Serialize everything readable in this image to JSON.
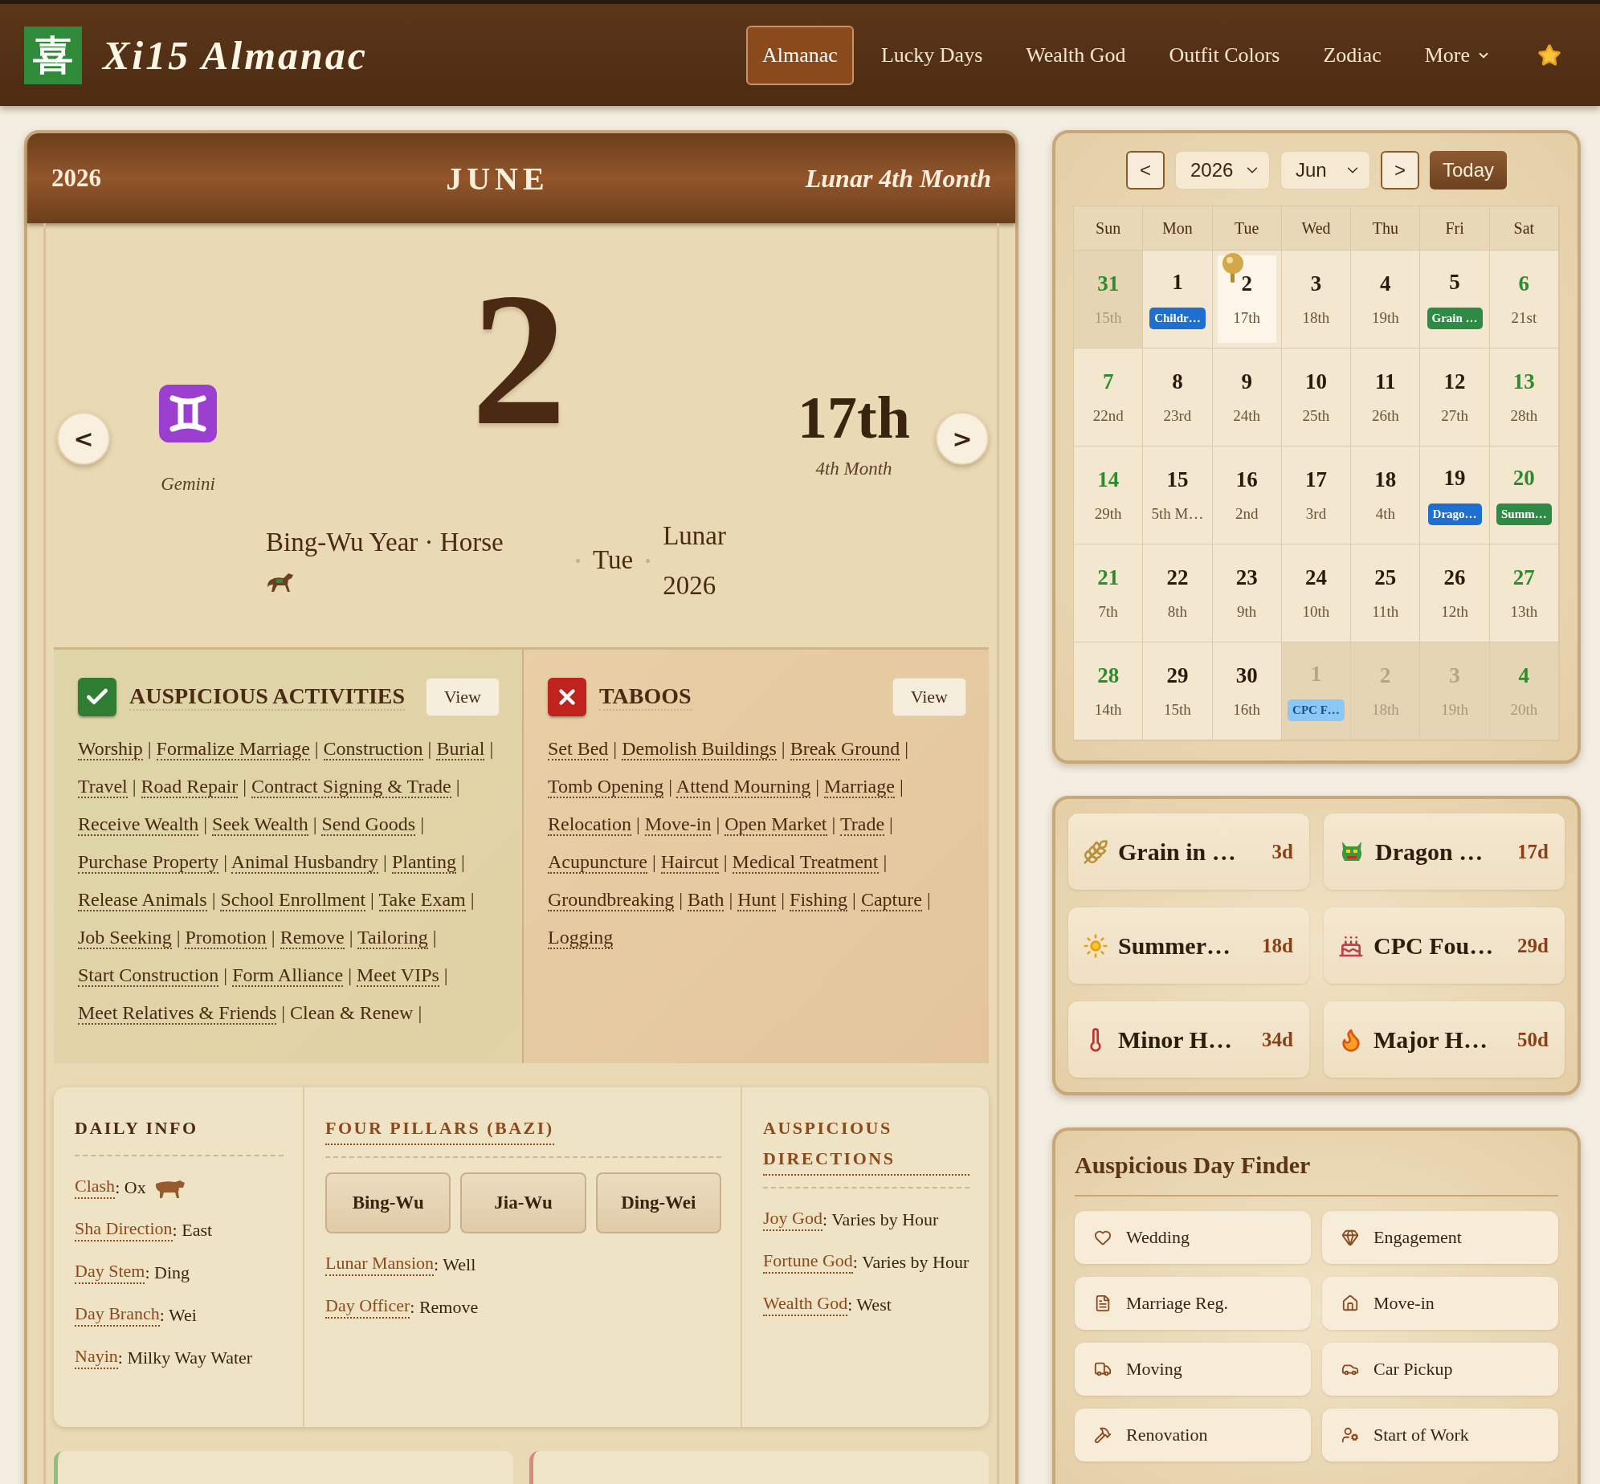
{
  "header": {
    "logo": "喜",
    "title": "Xi15 Almanac",
    "nav": [
      {
        "label": "Almanac",
        "selected": true,
        "kind": "link"
      },
      {
        "label": "Lucky Days",
        "selected": false,
        "kind": "link"
      },
      {
        "label": "Wealth God",
        "selected": false,
        "kind": "link"
      },
      {
        "label": "Outfit Colors",
        "selected": false,
        "kind": "link"
      },
      {
        "label": "Zodiac",
        "selected": false,
        "kind": "link"
      },
      {
        "label": "More",
        "selected": false,
        "kind": "menu"
      }
    ]
  },
  "day_card": {
    "year": "2026",
    "month": "JUNE",
    "lunar_month": "Lunar 4th Month",
    "prev": "<",
    "next": ">",
    "zodiac": "Gemini",
    "day": "2",
    "lunar_day": "17th",
    "lunar_day_month": "4th Month",
    "year_name": "Bing-Wu Year · Horse",
    "weekday": "Tue",
    "lunar_year": "Lunar 2026"
  },
  "activities": {
    "title": "AUSPICIOUS ACTIVITIES",
    "button": "View",
    "separator": "|",
    "trailing_separator": true,
    "items": [
      {
        "text": "Worship",
        "linked": true
      },
      {
        "text": "Formalize Marriage",
        "linked": true
      },
      {
        "text": "Construction",
        "linked": true
      },
      {
        "text": "Burial",
        "linked": true
      },
      {
        "text": "Travel",
        "linked": true
      },
      {
        "text": "Road Repair",
        "linked": true
      },
      {
        "text": "Contract Signing & Trade",
        "linked": true
      },
      {
        "text": "Receive Wealth",
        "linked": true
      },
      {
        "text": "Seek Wealth",
        "linked": true
      },
      {
        "text": "Send Goods",
        "linked": true
      },
      {
        "text": "Purchase Property",
        "linked": true
      },
      {
        "text": "Animal Husbandry",
        "linked": true
      },
      {
        "text": "Planting",
        "linked": true
      },
      {
        "text": "Release Animals",
        "linked": true
      },
      {
        "text": "School Enrollment",
        "linked": true
      },
      {
        "text": "Take Exam",
        "linked": true
      },
      {
        "text": "Job Seeking",
        "linked": true
      },
      {
        "text": "Promotion",
        "linked": true
      },
      {
        "text": "Remove",
        "linked": true
      },
      {
        "text": "Tailoring",
        "linked": true
      },
      {
        "text": "Start Construction",
        "linked": true
      },
      {
        "text": "Form Alliance",
        "linked": true
      },
      {
        "text": "Meet VIPs",
        "linked": true
      },
      {
        "text": "Meet Relatives & Friends",
        "linked": true
      },
      {
        "text": "Clean & Renew",
        "linked": false
      }
    ]
  },
  "taboos": {
    "title": "TABOOS",
    "button": "View",
    "separator": "|",
    "trailing_separator": false,
    "items": [
      {
        "text": "Set Bed",
        "linked": true
      },
      {
        "text": "Demolish Buildings",
        "linked": true
      },
      {
        "text": "Break Ground",
        "linked": true
      },
      {
        "text": "Tomb Opening",
        "linked": true
      },
      {
        "text": "Attend Mourning",
        "linked": true
      },
      {
        "text": "Marriage",
        "linked": true
      },
      {
        "text": "Relocation",
        "linked": true
      },
      {
        "text": "Move-in",
        "linked": true
      },
      {
        "text": "Open Market",
        "linked": true
      },
      {
        "text": "Trade",
        "linked": true
      },
      {
        "text": "Acupuncture",
        "linked": true
      },
      {
        "text": "Haircut",
        "linked": true
      },
      {
        "text": "Medical Treatment",
        "linked": true
      },
      {
        "text": "Groundbreaking",
        "linked": true
      },
      {
        "text": "Bath",
        "linked": true
      },
      {
        "text": "Hunt",
        "linked": true
      },
      {
        "text": "Fishing",
        "linked": true
      },
      {
        "text": "Capture",
        "linked": true
      },
      {
        "text": "Logging",
        "linked": true
      }
    ]
  },
  "daily_info": {
    "title": "DAILY INFO",
    "linked": false,
    "items": [
      {
        "label": "Clash",
        "value": ": Ox"
      },
      {
        "label": "Sha Direction",
        "value": ": East"
      },
      {
        "label": "Day Stem",
        "value": ": Ding"
      },
      {
        "label": "Day Branch",
        "value": ": Wei"
      },
      {
        "label": "Nayin",
        "value": ": Milky Way Water"
      }
    ]
  },
  "four_pillars": {
    "title": "FOUR PILLARS (BAZI)",
    "linked": true,
    "pillars": [
      "Bing-Wu",
      "Jia-Wu",
      "Ding-Wei"
    ],
    "items": [
      {
        "label": "Lunar Mansion",
        "value": ": Well"
      },
      {
        "label": "Day Officer",
        "value": ": Remove"
      }
    ]
  },
  "directions": {
    "title": "AUSPICIOUS DIRECTIONS",
    "linked": true,
    "items": [
      {
        "label": "Joy God",
        "value": ": Varies by Hour"
      },
      {
        "label": "Fortune God",
        "value": ": Varies by Hour"
      },
      {
        "label": "Wealth God",
        "value": ": West"
      }
    ]
  },
  "lower_cards": [
    {
      "color": "#8fbf7f"
    },
    {
      "color": "#d98a80"
    }
  ],
  "calendar": {
    "prev": "<",
    "next": ">",
    "year": "2026",
    "month": "Jun",
    "today": "Today",
    "weekdays": [
      "Sun",
      "Mon",
      "Tue",
      "Wed",
      "Thu",
      "Fri",
      "Sat"
    ],
    "weeks": [
      [
        {
          "day": "31",
          "lunar": "15th",
          "outside": true,
          "selected": false
        },
        {
          "day": "1",
          "badge": {
            "text": "Childr…",
            "color": "#1f6fd0"
          },
          "outside": false,
          "selected": false
        },
        {
          "day": "2",
          "lunar": "17th",
          "outside": false,
          "selected": true
        },
        {
          "day": "3",
          "lunar": "18th",
          "outside": false,
          "selected": false
        },
        {
          "day": "4",
          "lunar": "19th",
          "outside": false,
          "selected": false
        },
        {
          "day": "5",
          "badge": {
            "text": "Grain …",
            "color": "#2e8b45"
          },
          "outside": false,
          "selected": false
        },
        {
          "day": "6",
          "lunar": "21st",
          "outside": false,
          "selected": false
        }
      ],
      [
        {
          "day": "7",
          "lunar": "22nd",
          "outside": false,
          "selected": false
        },
        {
          "day": "8",
          "lunar": "23rd",
          "outside": false,
          "selected": false
        },
        {
          "day": "9",
          "lunar": "24th",
          "outside": false,
          "selected": false
        },
        {
          "day": "10",
          "lunar": "25th",
          "outside": false,
          "selected": false
        },
        {
          "day": "11",
          "lunar": "26th",
          "outside": false,
          "selected": false
        },
        {
          "day": "12",
          "lunar": "27th",
          "outside": false,
          "selected": false
        },
        {
          "day": "13",
          "lunar": "28th",
          "outside": false,
          "selected": false
        }
      ],
      [
        {
          "day": "14",
          "lunar": "29th",
          "outside": false,
          "selected": false
        },
        {
          "day": "15",
          "lunar": "5th M…",
          "outside": false,
          "selected": false
        },
        {
          "day": "16",
          "lunar": "2nd",
          "outside": false,
          "selected": false
        },
        {
          "day": "17",
          "lunar": "3rd",
          "outside": false,
          "selected": false
        },
        {
          "day": "18",
          "lunar": "4th",
          "outside": false,
          "selected": false
        },
        {
          "day": "19",
          "badge": {
            "text": "Drago…",
            "color": "#1f6fd0"
          },
          "outside": false,
          "selected": false
        },
        {
          "day": "20",
          "badge": {
            "text": "Summ…",
            "color": "#2e8b45"
          },
          "outside": false,
          "selected": false
        }
      ],
      [
        {
          "day": "21",
          "lunar": "7th",
          "outside": false,
          "selected": false
        },
        {
          "day": "22",
          "lunar": "8th",
          "outside": false,
          "selected": false
        },
        {
          "day": "23",
          "lunar": "9th",
          "outside": false,
          "selected": false
        },
        {
          "day": "24",
          "lunar": "10th",
          "outside": false,
          "selected": false
        },
        {
          "day": "25",
          "lunar": "11th",
          "outside": false,
          "selected": false
        },
        {
          "day": "26",
          "lunar": "12th",
          "outside": false,
          "selected": false
        },
        {
          "day": "27",
          "lunar": "13th",
          "outside": false,
          "selected": false
        }
      ],
      [
        {
          "day": "28",
          "lunar": "14th",
          "outside": false,
          "selected": false
        },
        {
          "day": "29",
          "lunar": "15th",
          "outside": false,
          "selected": false
        },
        {
          "day": "30",
          "lunar": "16th",
          "outside": false,
          "selected": false
        },
        {
          "day": "1",
          "badge": {
            "text": "CPC F…",
            "color": "#8cc8f5"
          },
          "outside": true,
          "selected": false
        },
        {
          "day": "2",
          "lunar": "18th",
          "outside": true,
          "selected": false
        },
        {
          "day": "3",
          "lunar": "19th",
          "outside": true,
          "selected": false
        },
        {
          "day": "4",
          "lunar": "20th",
          "outside": true,
          "selected": false
        }
      ]
    ]
  },
  "festivals": [
    {
      "name": "Grain in …",
      "days": "3d"
    },
    {
      "name": "Dragon …",
      "days": "17d"
    },
    {
      "name": "Summer…",
      "days": "18d"
    },
    {
      "name": "CPC Fou…",
      "days": "29d"
    },
    {
      "name": "Minor H…",
      "days": "34d"
    },
    {
      "name": "Major H…",
      "days": "50d"
    }
  ],
  "finder": {
    "title": "Auspicious Day Finder",
    "items": [
      {
        "label": "Wedding"
      },
      {
        "label": "Engagement"
      },
      {
        "label": "Marriage Reg."
      },
      {
        "label": "Move-in"
      },
      {
        "label": "Moving"
      },
      {
        "label": "Car Pickup"
      },
      {
        "label": "Renovation"
      },
      {
        "label": "Start of Work"
      }
    ]
  }
}
